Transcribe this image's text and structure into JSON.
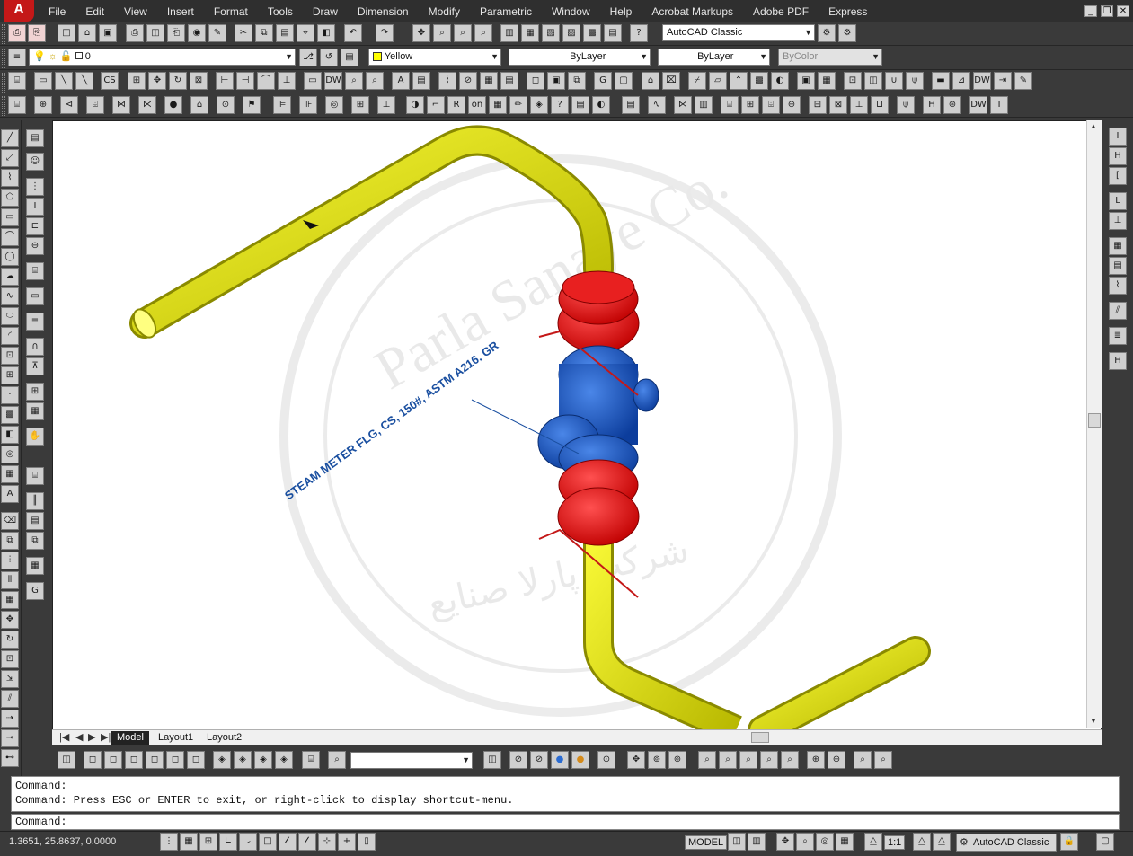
{
  "menubar": {
    "items": [
      "File",
      "Edit",
      "View",
      "Insert",
      "Format",
      "Tools",
      "Draw",
      "Dimension",
      "Modify",
      "Parametric",
      "Window",
      "Help",
      "Acrobat Markups",
      "Adobe PDF",
      "Express"
    ]
  },
  "toolbars": {
    "workspace": "AutoCAD Classic",
    "layer": "0",
    "color": "Yellow",
    "linetype": "ByLayer",
    "lineweight": "ByLayer",
    "plotstyle": "ByColor"
  },
  "drawing": {
    "watermark": "Parla Sanaye Co.",
    "watermark_fa": "شرکت پارلا صنایع",
    "label": "STEAM METER FLG, CS, 150#, ASTM A216, GR",
    "colors": {
      "pipe": "#e8e800",
      "flange": "#e01010",
      "valve": "#1450c0",
      "leader": "#c41818",
      "text": "#1a4fa0"
    }
  },
  "tabs": [
    "Model",
    "Layout1",
    "Layout2"
  ],
  "command": {
    "line1": "Command:",
    "line2": "Command: Press ESC or ENTER to exit, or right-click to display shortcut-menu.",
    "prompt": "Command:"
  },
  "status": {
    "coords": "1.3651, 25.8637, 0.0000",
    "model": "MODEL",
    "scale": "1:1",
    "workspace": "AutoCAD Classic"
  }
}
